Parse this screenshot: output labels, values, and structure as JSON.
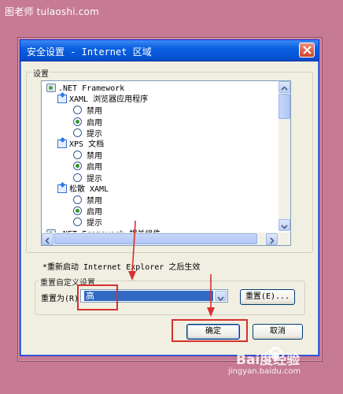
{
  "watermark": {
    "top": "图老师 tulaoshi.com",
    "bottom_brand": "Bai度经验",
    "bottom_url": "jingyan.baidu.com"
  },
  "dialog": {
    "title": "安全设置 - Internet 区域",
    "settings_group_label": "设置",
    "tree": [
      {
        "type": "category",
        "icon": "gear-icon",
        "label": ".NET Framework"
      },
      {
        "type": "sub",
        "icon": "xaml-page-icon",
        "label": "XAML 浏览器应用程序"
      },
      {
        "type": "option",
        "label": "禁用",
        "selected": false
      },
      {
        "type": "option",
        "label": "启用",
        "selected": true
      },
      {
        "type": "option",
        "label": "提示",
        "selected": false
      },
      {
        "type": "sub",
        "icon": "xps-page-icon",
        "label": "XPS 文档"
      },
      {
        "type": "option",
        "label": "禁用",
        "selected": false
      },
      {
        "type": "option",
        "label": "启用",
        "selected": true
      },
      {
        "type": "option",
        "label": "提示",
        "selected": false
      },
      {
        "type": "sub",
        "icon": "loose-xaml-page-icon",
        "label": "松散 XAML"
      },
      {
        "type": "option",
        "label": "禁用",
        "selected": false
      },
      {
        "type": "option",
        "label": "启用",
        "selected": true
      },
      {
        "type": "option",
        "label": "提示",
        "selected": false
      },
      {
        "type": "category",
        "icon": "gear-icon",
        "label": ".NET Framework 相关组件"
      }
    ],
    "restart_note": "*重新启动 Internet Explorer 之后生效",
    "reset_group_label": "重置自定义设置",
    "reset_to_label": "重置为(R):",
    "reset_level": "高",
    "reset_button": "重置(E)...",
    "ok_button": "确定",
    "cancel_button": "取消"
  },
  "colors": {
    "background": "#c67a93",
    "titlebar": "#0a5fe0",
    "highlight_box": "#d7302e",
    "selected_item": "#316ac5"
  }
}
